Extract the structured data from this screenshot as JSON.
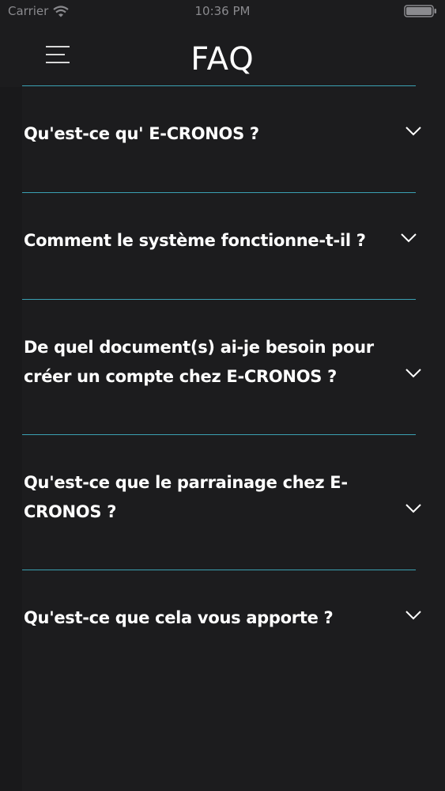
{
  "status_bar": {
    "carrier": "Carrier",
    "time": "10:36 PM"
  },
  "header": {
    "title": "FAQ",
    "menu_icon": "hamburger-icon"
  },
  "colors": {
    "background": "#1c1c1e",
    "divider": "#3aa0b2",
    "text": "#ffffff"
  },
  "faq": {
    "items": [
      {
        "question": "Qu'est-ce qu' E-CRONOS ?"
      },
      {
        "question": "Comment le système fonctionne-t-il ?"
      },
      {
        "question": "De quel document(s) ai-je besoin pour créer un compte chez E-CRONOS ?"
      },
      {
        "question": "Qu'est-ce que le parrainage chez E-CRONOS ?"
      },
      {
        "question": "Qu'est-ce que cela vous apporte ?"
      }
    ]
  }
}
